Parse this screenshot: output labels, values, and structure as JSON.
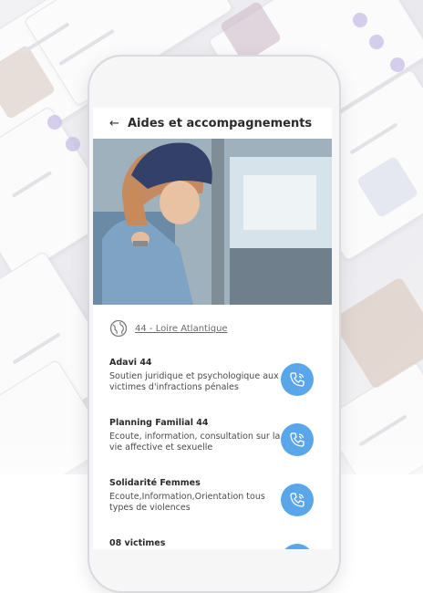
{
  "header": {
    "back_icon": "arrow-left-icon",
    "title": "Aides et accompagnements"
  },
  "region": {
    "icon": "globe-icon",
    "label": "44 - Loire Atlantique"
  },
  "organizations": [
    {
      "name": "Adavi 44",
      "description": "Soutien juridique et psychologique aux victimes d'infractions pénales",
      "action_icon": "phone-call-icon"
    },
    {
      "name": "Planning Familial 44",
      "description": "Ecoute, information, consultation sur la vie affective et sexuelle",
      "action_icon": "phone-call-icon"
    },
    {
      "name": "Solidarité Femmes",
      "description": "Ecoute,Information,Orientation tous types de violences",
      "action_icon": "phone-call-icon"
    },
    {
      "name": "08 victimes",
      "description": "",
      "action_icon": "phone-call-icon"
    }
  ],
  "colors": {
    "accent": "#5aa6ea",
    "background_dots": "#c7bde6",
    "title_text": "#2b2b2b"
  }
}
